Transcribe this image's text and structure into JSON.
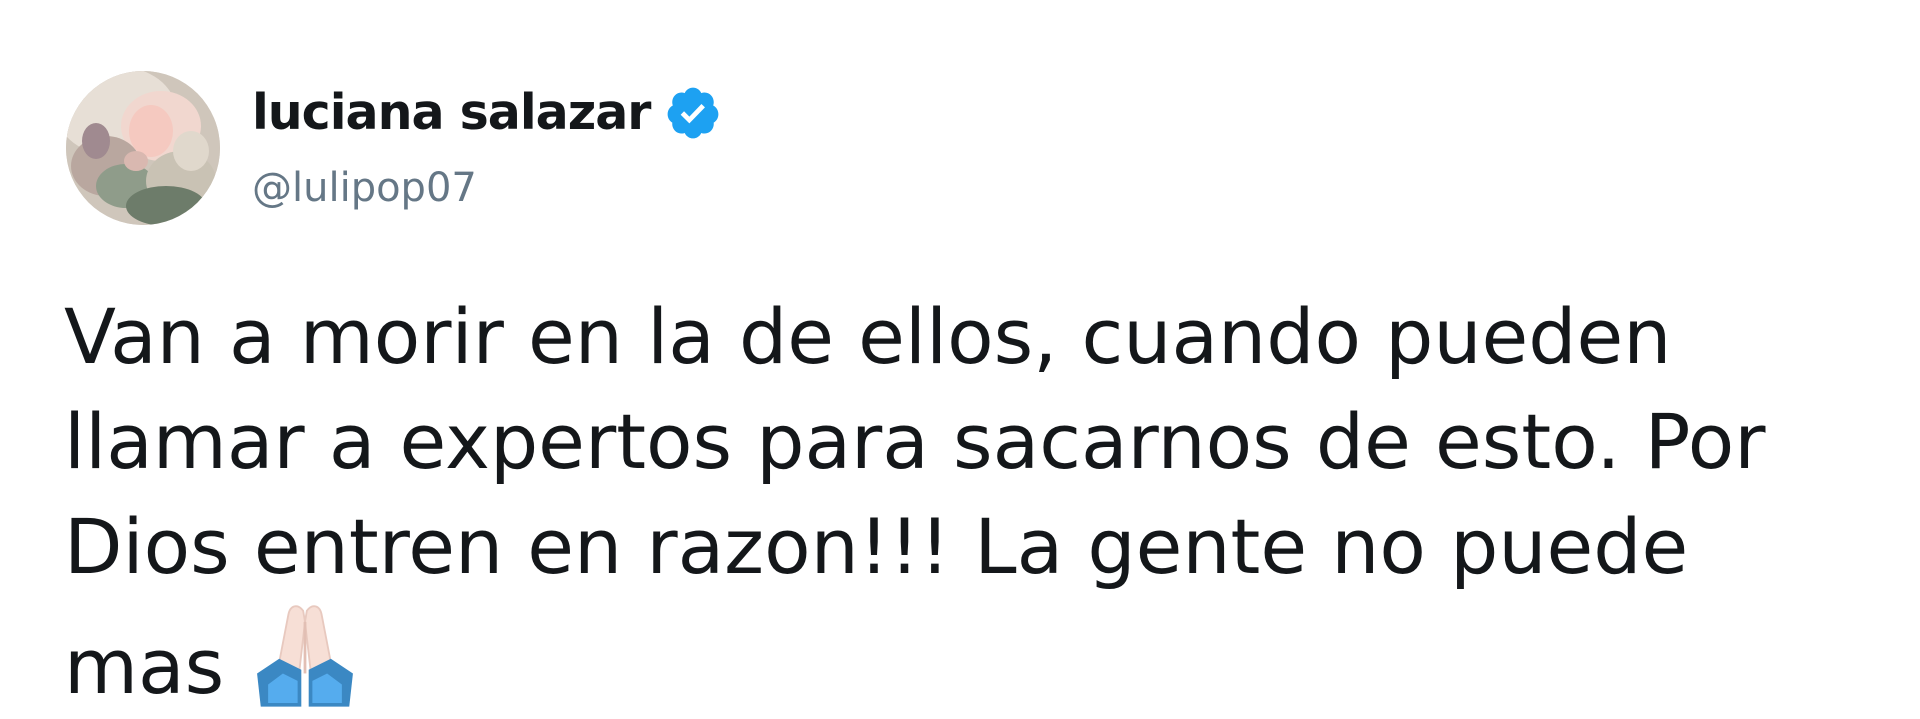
{
  "tweet": {
    "author": {
      "display_name": "luciana salazar",
      "handle": "@lulipop07",
      "verified": true,
      "verified_color": "#1da1f2"
    },
    "text_lines": [
      "Van a morir en la de ellos, cuando pueden",
      "llamar a expertos para sacarnos de esto. Por",
      "Dios entren en razon!!! La gente no puede",
      "mas"
    ],
    "emoji": "folded-hands-light-skin-tone",
    "colors": {
      "text": "#14171a",
      "handle": "#657786",
      "background": "#ffffff"
    }
  }
}
